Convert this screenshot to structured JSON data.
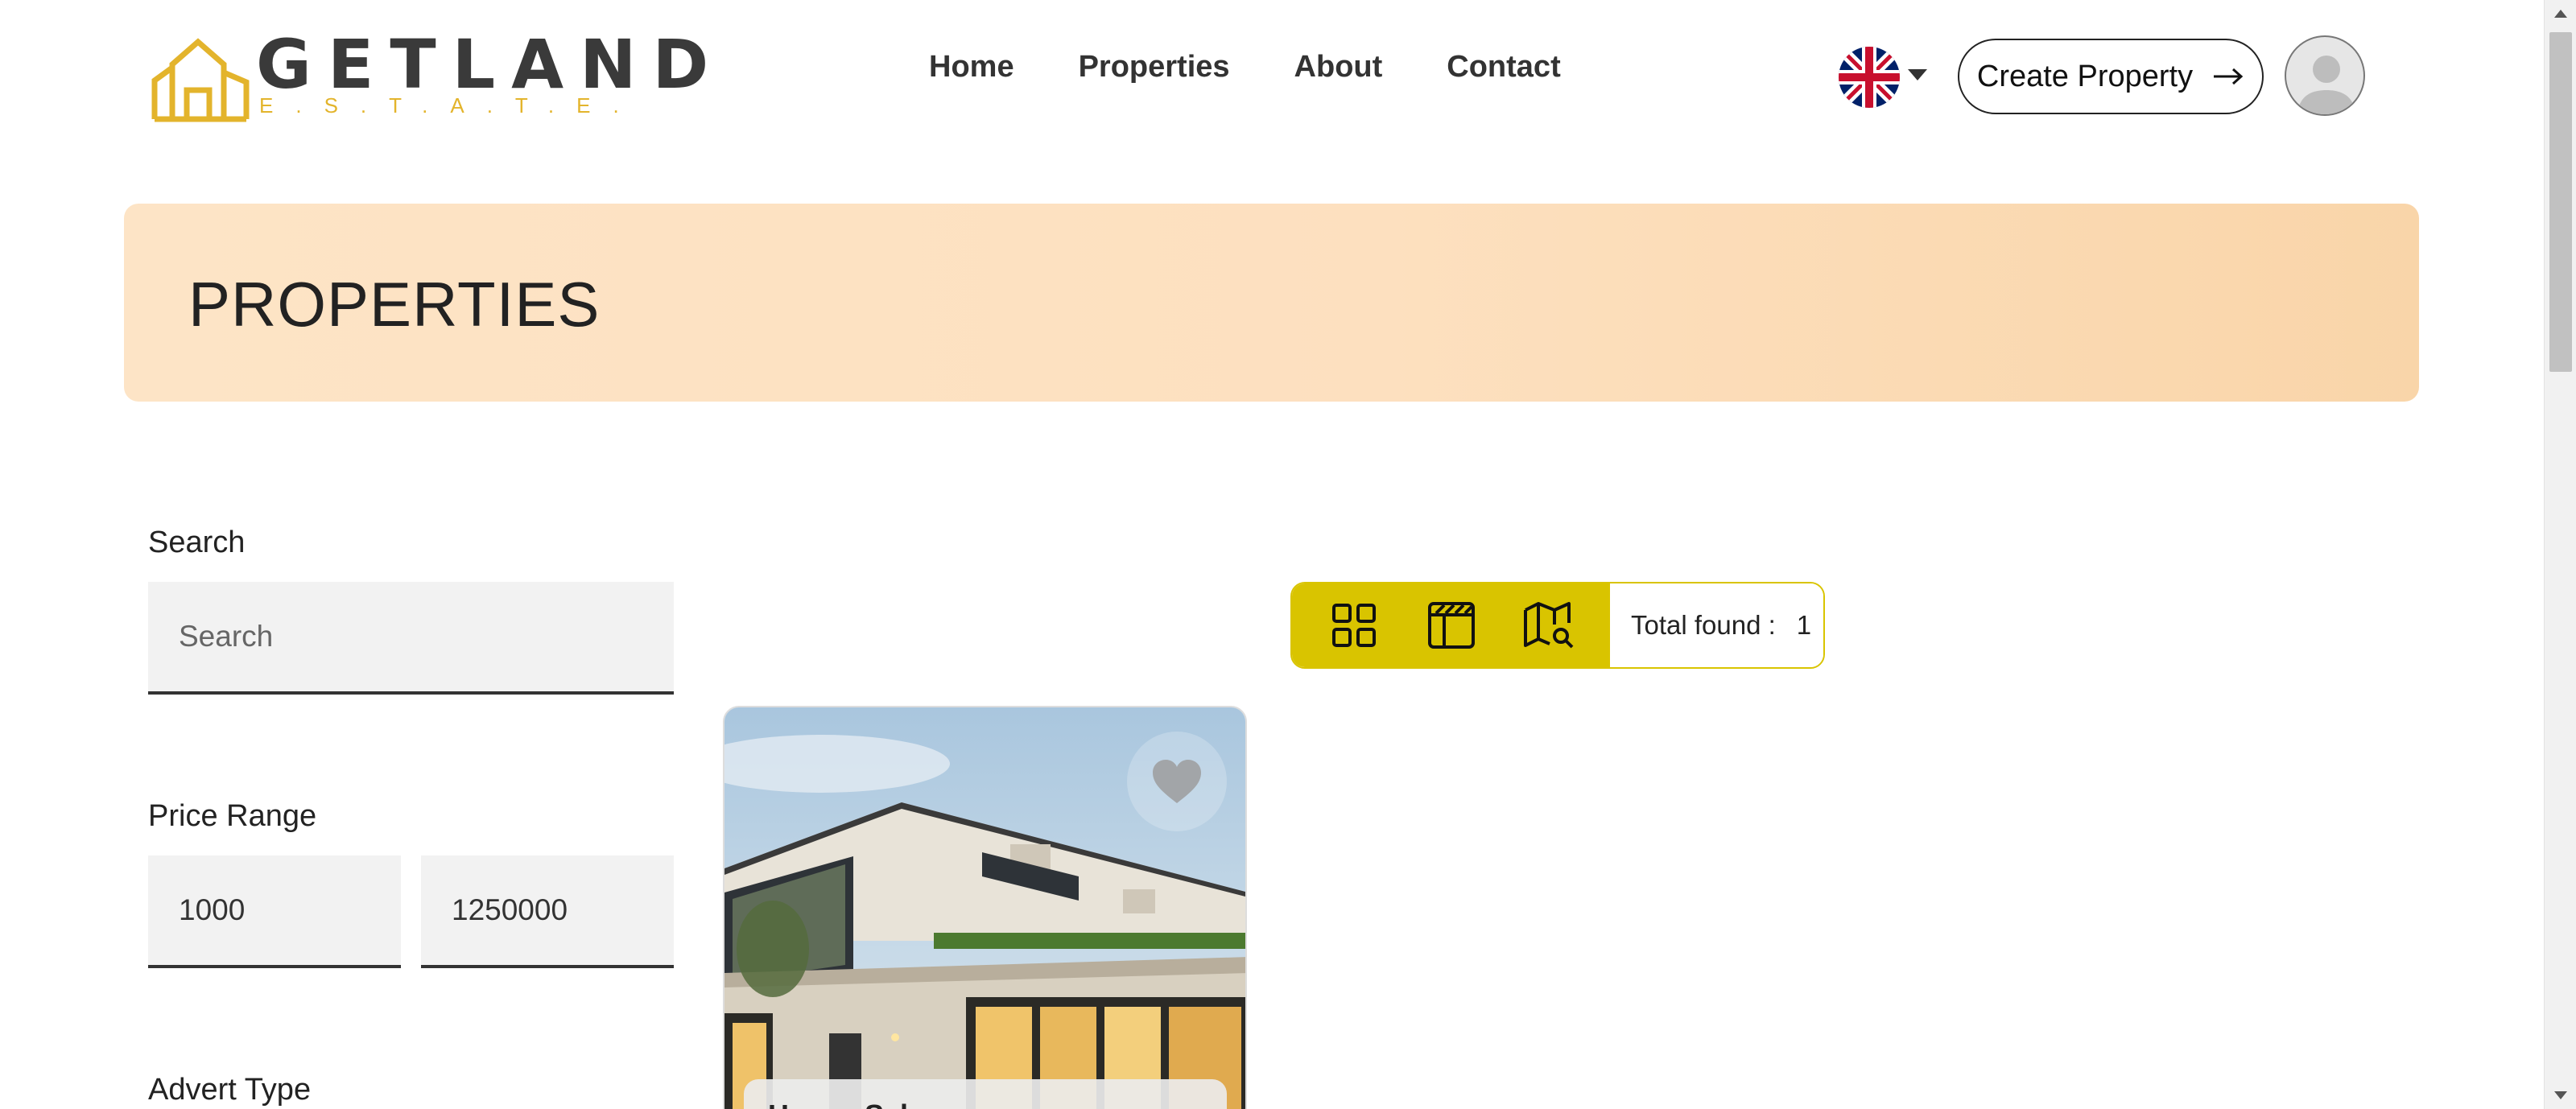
{
  "brand": {
    "name": "GETLAND",
    "tagline": "E.S.T.A.T.E.",
    "accent_color": "#e3b42c"
  },
  "nav": {
    "items": [
      {
        "label": "Home"
      },
      {
        "label": "Properties"
      },
      {
        "label": "About"
      },
      {
        "label": "Contact"
      }
    ]
  },
  "header": {
    "language_icon": "uk-flag-icon",
    "create_label": "Create Property",
    "create_icon": "arrow-right-icon",
    "avatar_icon": "user-avatar-icon"
  },
  "banner": {
    "title": "PROPERTIES",
    "gradient": [
      "#fde4c6",
      "#f9d5a9"
    ]
  },
  "filters": {
    "search": {
      "label": "Search",
      "placeholder": "Search",
      "value": ""
    },
    "price": {
      "label": "Price Range",
      "min": "1000",
      "max": "1250000"
    },
    "advert_type": {
      "label": "Advert Type"
    }
  },
  "toolbar": {
    "views": [
      {
        "icon": "grid-view-icon"
      },
      {
        "icon": "list-view-icon"
      },
      {
        "icon": "map-search-icon"
      }
    ],
    "total_label": "Total found :",
    "total_count": "1",
    "color": "#d9c400"
  },
  "listings": [
    {
      "image": "modern-house-photo",
      "favorite_icon": "heart-icon",
      "title": "House Sale"
    }
  ]
}
